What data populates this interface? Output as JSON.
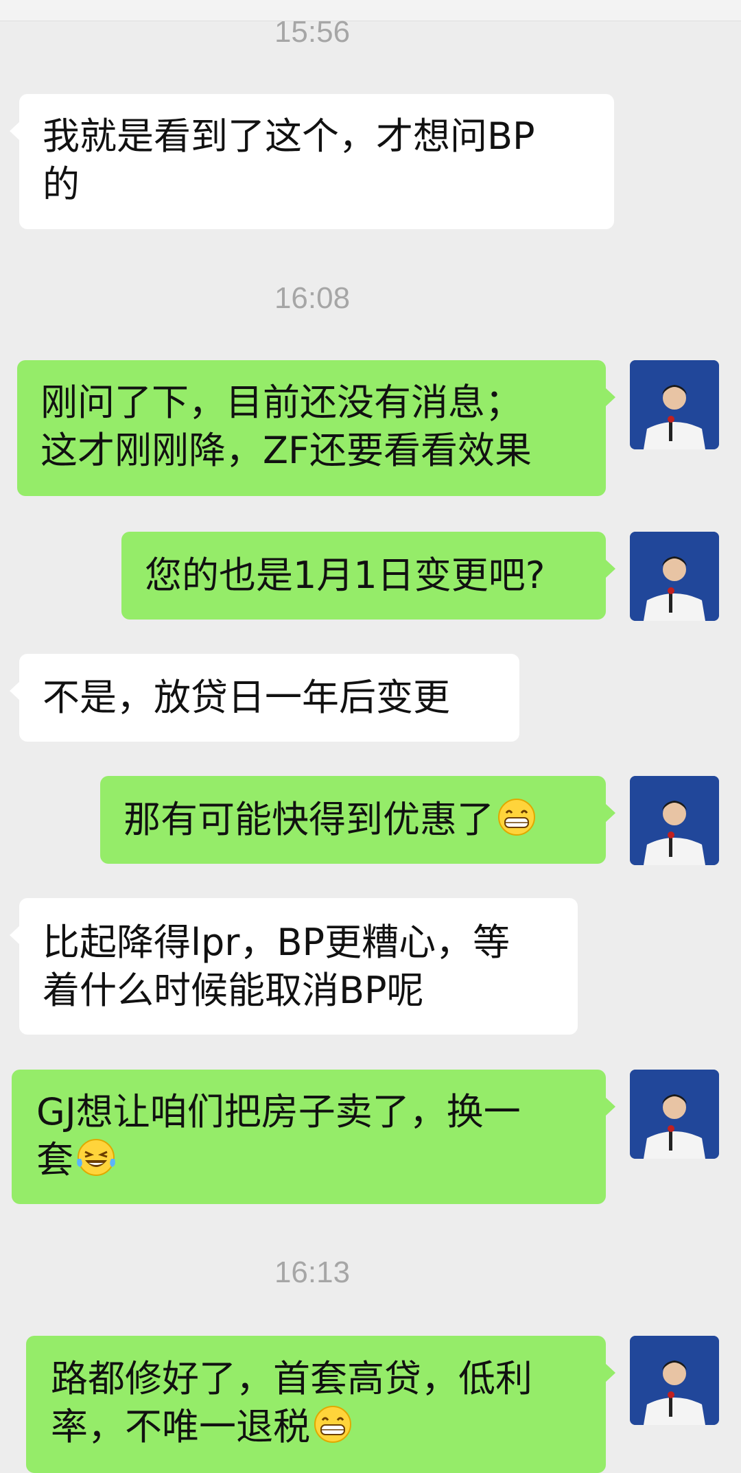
{
  "messages": [
    {
      "type": "time",
      "text": "15:56"
    },
    {
      "type": "in",
      "text": "我就是看到了这个，才想问BP\n的"
    },
    {
      "type": "time",
      "text": "16:08"
    },
    {
      "type": "out",
      "text": "刚问了下，目前还没有消息；\n这才刚刚降，ZF还要看看效果"
    },
    {
      "type": "out",
      "text": "您的也是1月1日变更吧?"
    },
    {
      "type": "in",
      "text": "不是，放贷日一年后变更"
    },
    {
      "type": "out",
      "text": "那有可能快得到优惠了",
      "emoji": "grin-emoji"
    },
    {
      "type": "in",
      "text": "比起降得lpr，BP更糟心，等\n着什么时候能取消BP呢"
    },
    {
      "type": "out",
      "text": "GJ想让咱们把房子卖了，换一\n套",
      "emoji": "laugh-tears-emoji"
    },
    {
      "type": "time",
      "text": "16:13"
    },
    {
      "type": "out",
      "text": "路都修好了，首套高贷，低利\n率，不唯一退税",
      "emoji": "grin-emoji"
    }
  ],
  "colors": {
    "background": "#ededed",
    "incoming": "#ffffff",
    "outgoing": "#95ec69",
    "timestamp": "#a6a6a6"
  },
  "icons": [
    "avatar-photo",
    "grin-emoji",
    "laugh-tears-emoji"
  ]
}
